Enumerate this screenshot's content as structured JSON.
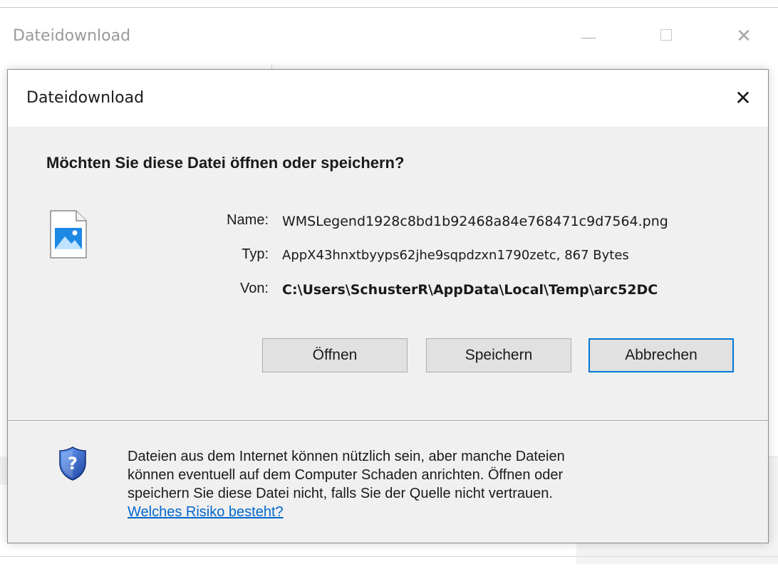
{
  "background_window": {
    "title": "Dateidownload",
    "minimize_glyph": "—",
    "maximize_glyph": "☐",
    "close_glyph": "✕"
  },
  "dialog": {
    "title": "Dateidownload",
    "close_glyph": "✕",
    "heading": "Möchten Sie diese Datei öffnen oder speichern?",
    "file_icon": "image-file-icon",
    "fields": {
      "name_label": "Name:",
      "name_value": "WMSLegend1928c8bd1b92468a84e768471c9d7564.png",
      "typ_label": "Typ:",
      "typ_value": "AppX43hnxtbyyps62jhe9sqpdzxn1790zetc, 867 Bytes",
      "von_label": "Von:",
      "von_value": "C:\\Users\\SchusterR\\AppData\\Local\\Temp\\arc52DC"
    },
    "buttons": {
      "open": "Öffnen",
      "save": "Speichern",
      "cancel": "Abbrechen"
    },
    "warning": {
      "icon": "security-shield-icon",
      "line1": "Dateien aus dem Internet können nützlich sein, aber manche Dateien",
      "line2": "können eventuell auf dem Computer Schaden anrichten. Öffnen oder",
      "line3": "speichern Sie diese Datei nicht, falls Sie der Quelle nicht vertrauen.",
      "link": "Welches Risiko besteht?"
    }
  },
  "colors": {
    "dialog_bg": "#f0f0f0",
    "title_bg": "#ffffff",
    "accent_focus": "#0078d7",
    "link": "#0066cc"
  }
}
